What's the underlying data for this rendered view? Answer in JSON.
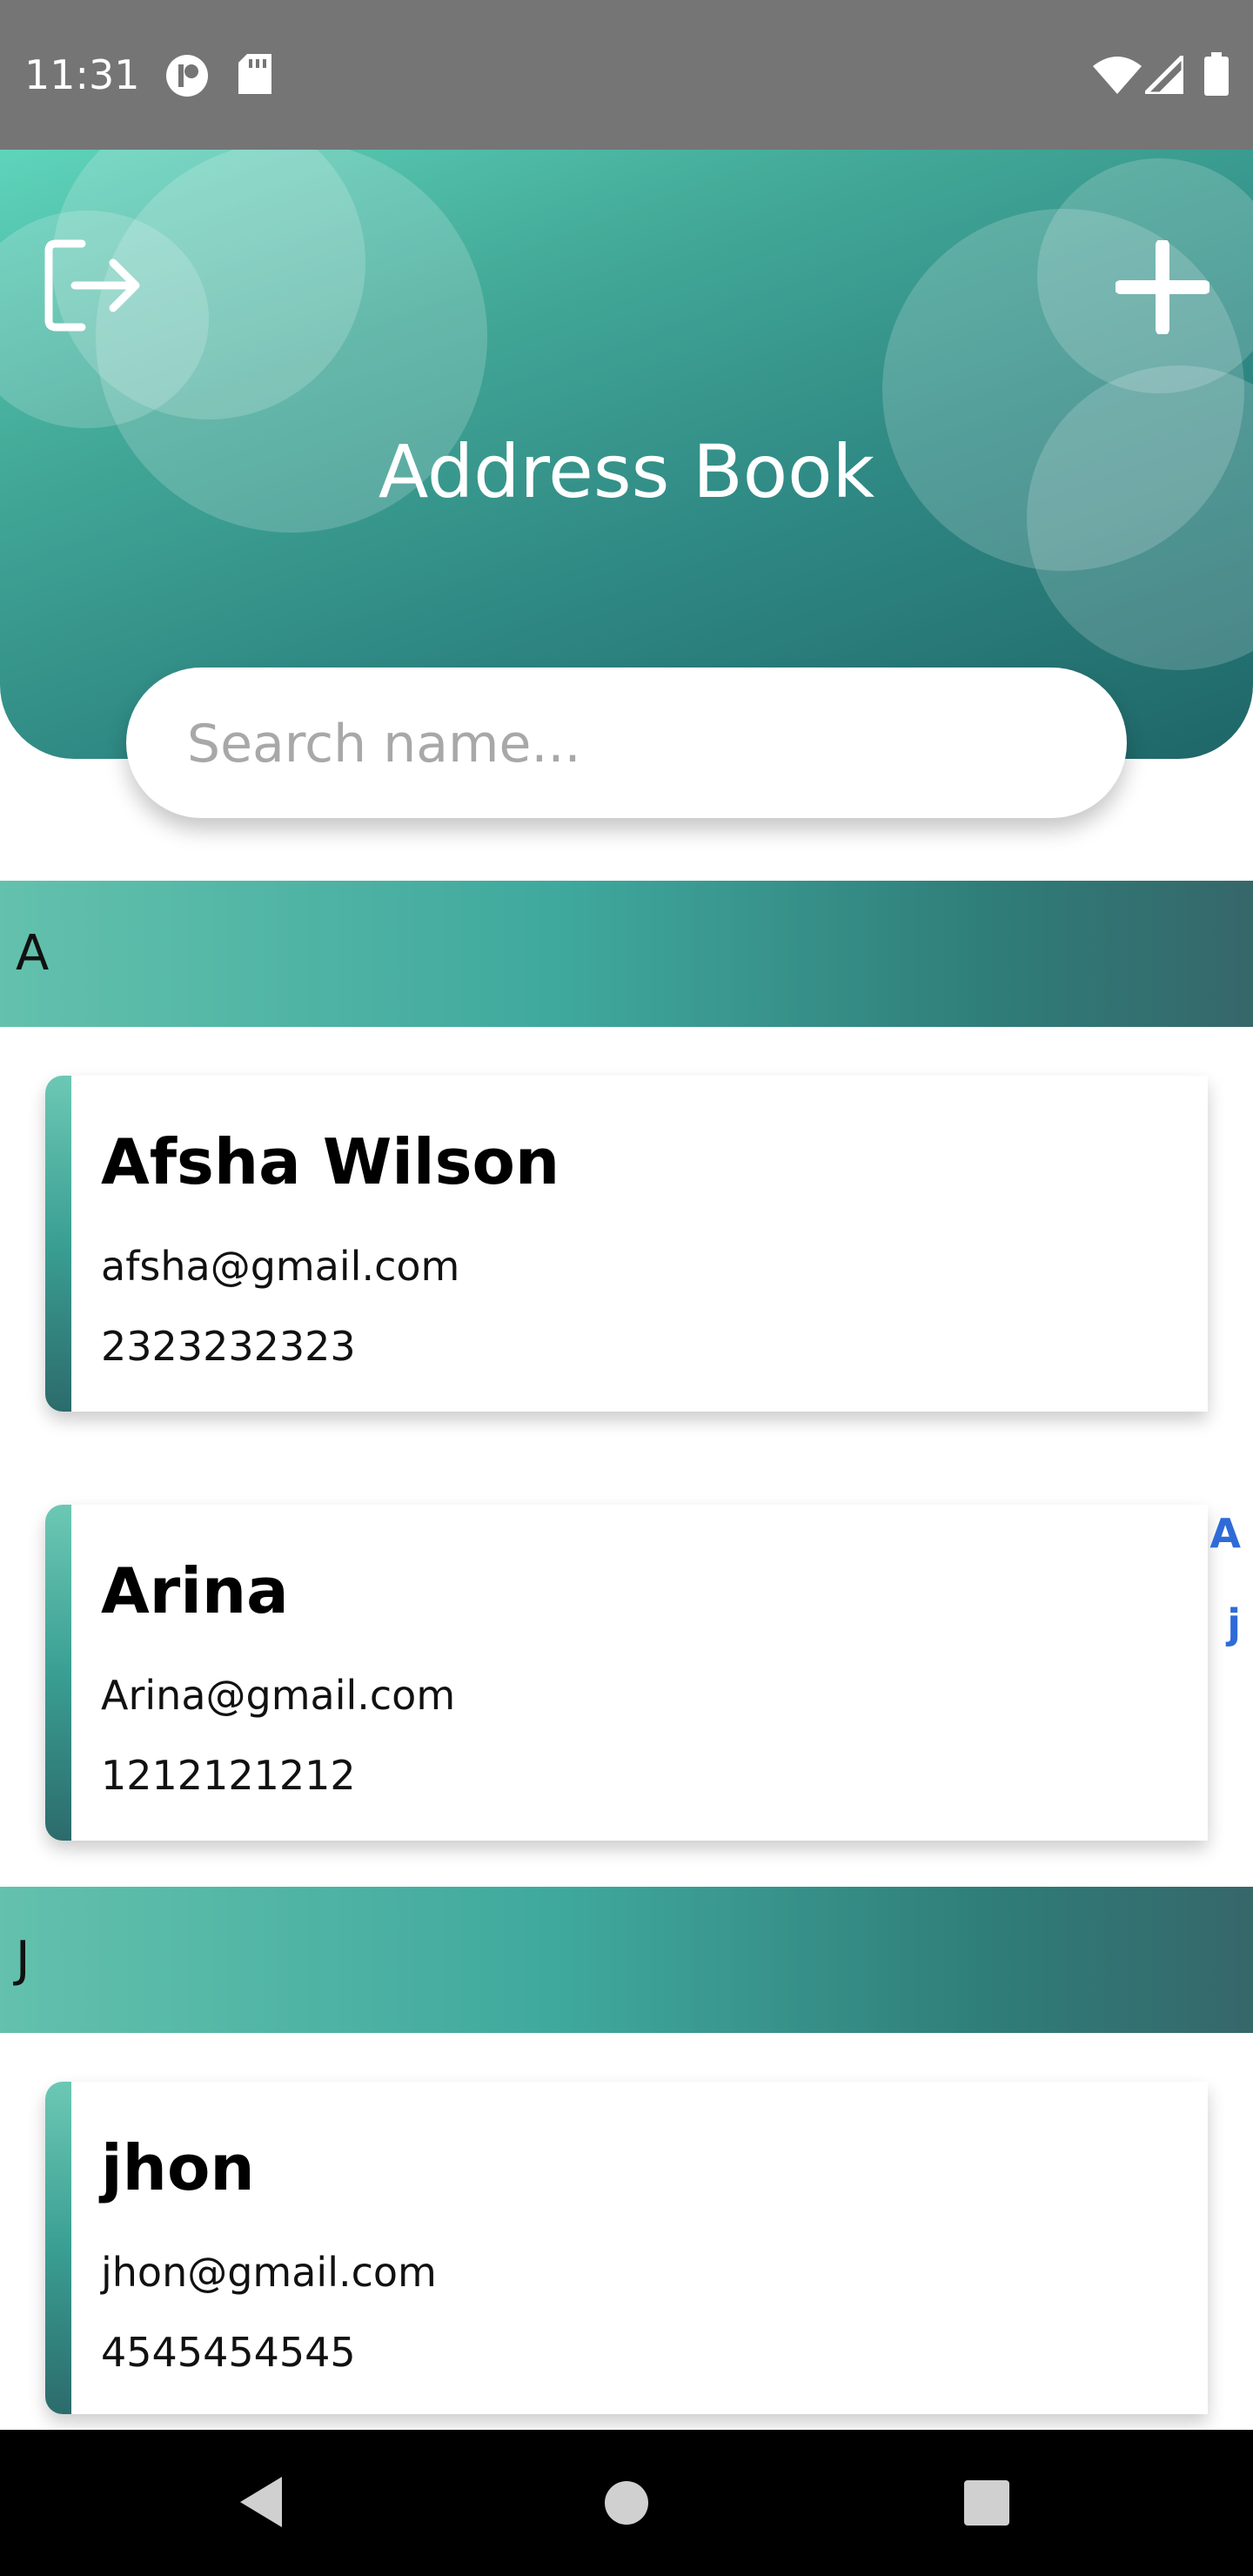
{
  "status_bar": {
    "time": "11:31",
    "icons": [
      "app-notification-icon",
      "sd-card-icon",
      "wifi-icon",
      "signal-icon",
      "battery-icon"
    ]
  },
  "header": {
    "title": "Address Book",
    "logout_icon": "logout-icon",
    "add_icon": "plus-icon"
  },
  "search": {
    "placeholder": "Search name...",
    "value": ""
  },
  "sections": [
    {
      "letter": "A",
      "contacts": [
        {
          "name": "Afsha Wilson",
          "email": "afsha@gmail.com",
          "phone": "2323232323"
        },
        {
          "name": "Arina",
          "email": "Arina@gmail.com",
          "phone": "1212121212"
        }
      ]
    },
    {
      "letter": "J",
      "contacts": [
        {
          "name": "jhon",
          "email": "jhon@gmail.com",
          "phone": "4545454545"
        }
      ]
    }
  ],
  "alphabet_index": [
    "A",
    "j"
  ],
  "nav_bar": {
    "buttons": [
      "back-icon",
      "home-icon",
      "recents-icon"
    ]
  },
  "colors": {
    "header_start": "#5fd4bb",
    "header_end": "#1f6668",
    "index_letter": "#2f6bd8",
    "status_bar": "#757575"
  }
}
